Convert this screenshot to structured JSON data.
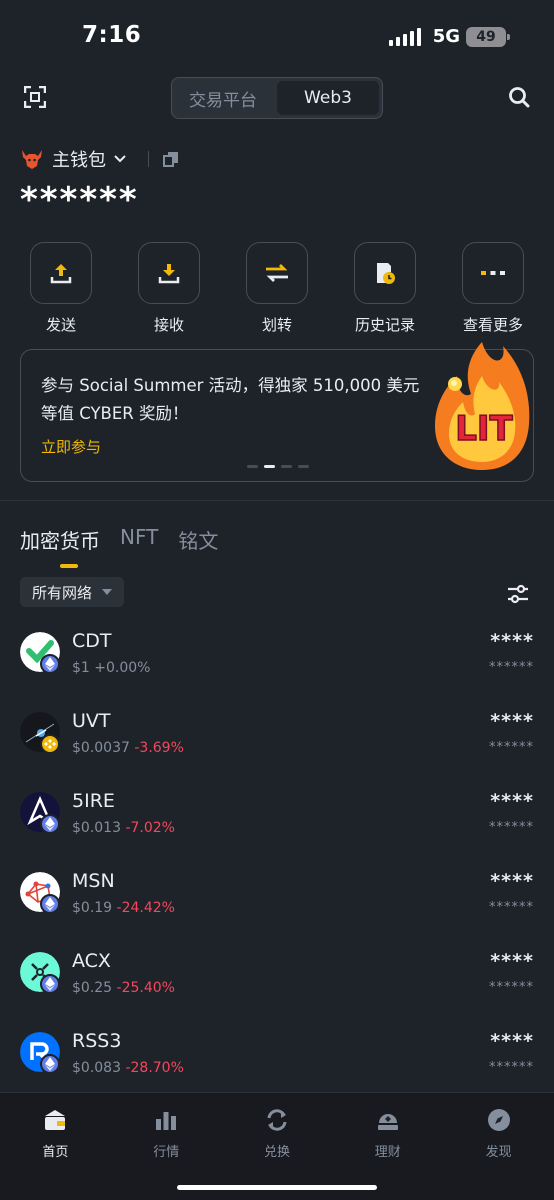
{
  "status": {
    "time": "7:16",
    "network": "5G",
    "battery": "49"
  },
  "header": {
    "segments": [
      {
        "label": "交易平台"
      },
      {
        "label": "Web3"
      }
    ],
    "active_segment": "Web3"
  },
  "wallet": {
    "name": "主钱包",
    "balance": "******"
  },
  "actions": [
    {
      "label": "发送",
      "icon": "send-icon"
    },
    {
      "label": "接收",
      "icon": "receive-icon"
    },
    {
      "label": "划转",
      "icon": "transfer-icon"
    },
    {
      "label": "历史记录",
      "icon": "history-icon"
    },
    {
      "label": "查看更多",
      "icon": "more-icon"
    }
  ],
  "banner": {
    "text": "参与 Social Summer 活动，得独家 510,000 美元等值 CYBER 奖励！",
    "link": "立即参与",
    "badge_text": "LIT",
    "pages": 4,
    "active_page": 2
  },
  "asset_tabs": [
    {
      "label": "加密货币"
    },
    {
      "label": "NFT"
    },
    {
      "label": "铭文"
    }
  ],
  "network_filter": {
    "label": "所有网络"
  },
  "tokens": [
    {
      "symbol": "CDT",
      "price": "$1",
      "change": "+0.00%",
      "change_sign": "neutral",
      "amount": "****",
      "value": "******",
      "icon_color": "#ffffff",
      "badge": "ethereum"
    },
    {
      "symbol": "UVT",
      "price": "$0.0037",
      "change": "-3.69%",
      "change_sign": "neg",
      "amount": "****",
      "value": "******",
      "icon_color": "#15171c",
      "badge": "bnb"
    },
    {
      "symbol": "5IRE",
      "price": "$0.013",
      "change": "-7.02%",
      "change_sign": "neg",
      "amount": "****",
      "value": "******",
      "icon_color": "#12123a",
      "badge": "ethereum"
    },
    {
      "symbol": "MSN",
      "price": "$0.19",
      "change": "-24.42%",
      "change_sign": "neg",
      "amount": "****",
      "value": "******",
      "icon_color": "#ffffff",
      "badge": "ethereum"
    },
    {
      "symbol": "ACX",
      "price": "$0.25",
      "change": "-25.40%",
      "change_sign": "neg",
      "amount": "****",
      "value": "******",
      "icon_color": "#6cf9d8",
      "badge": "ethereum"
    },
    {
      "symbol": "RSS3",
      "price": "$0.083",
      "change": "-28.70%",
      "change_sign": "neg",
      "amount": "****",
      "value": "******",
      "icon_color": "#0072ff",
      "badge": "ethereum"
    }
  ],
  "bottom_nav": [
    {
      "label": "首页",
      "icon": "wallet-home-icon",
      "active": true
    },
    {
      "label": "行情",
      "icon": "market-icon",
      "active": false
    },
    {
      "label": "兑换",
      "icon": "swap-icon",
      "active": false
    },
    {
      "label": "理财",
      "icon": "earn-icon",
      "active": false
    },
    {
      "label": "发现",
      "icon": "discover-icon",
      "active": false
    }
  ],
  "colors": {
    "accent": "#f0b90b",
    "negative": "#f6465d",
    "background": "#1e2329",
    "muted": "#848e9c"
  }
}
